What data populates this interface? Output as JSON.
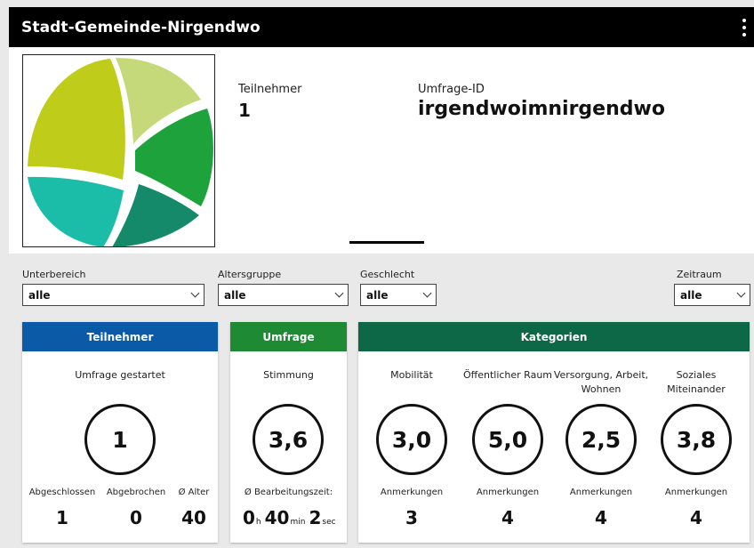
{
  "header": {
    "title": "Stadt-Gemeinde-Nirgendwo"
  },
  "summary": {
    "participants_label": "Teilnehmer",
    "participants_value": "1",
    "survey_id_label": "Umfrage-ID",
    "survey_id_value": "irgendwoimnirgendwo"
  },
  "filters": {
    "subarea": {
      "label": "Unterbereich",
      "value": "alle"
    },
    "age_group": {
      "label": "Altersgruppe",
      "value": "alle"
    },
    "gender": {
      "label": "Geschlecht",
      "value": "alle"
    },
    "period": {
      "label": "Zeitraum",
      "value": "alle"
    }
  },
  "cards": {
    "participants": {
      "title": "Teilnehmer",
      "color": "#0a5aa8",
      "started_label": "Umfrage gestartet",
      "started_value": "1",
      "completed_label": "Abgeschlossen",
      "completed_value": "1",
      "aborted_label": "Abgebrochen",
      "aborted_value": "0",
      "age_label": "Ø Alter",
      "age_value": "40"
    },
    "survey": {
      "title": "Umfrage",
      "color": "#1e8a34",
      "mood_label": "Stimmung",
      "mood_value": "3,6",
      "duration_label": "Ø Bearbeitungszeit:",
      "hours": "0",
      "hours_unit": "h",
      "minutes": "40",
      "minutes_unit": "min",
      "seconds": "2",
      "seconds_unit": "sec"
    },
    "categories": {
      "title": "Kategorien",
      "color": "#0d6848",
      "items": [
        {
          "label": "Mobilität",
          "score": "3,0",
          "notes_label": "Anmerkungen",
          "notes_value": "3"
        },
        {
          "label": "Öffentlicher Raum",
          "score": "5,0",
          "notes_label": "Anmerkungen",
          "notes_value": "4"
        },
        {
          "label": "Versorgung, Arbeit, Wohnen",
          "score": "2,5",
          "notes_label": "Anmerkungen",
          "notes_value": "4"
        },
        {
          "label": "Soziales Miteinander",
          "score": "3,8",
          "notes_label": "Anmerkungen",
          "notes_value": "4"
        }
      ]
    }
  },
  "icons": {
    "menu": "more-vertical-icon",
    "dropdown": "chevron-down-icon",
    "logo": "municipality-logo"
  }
}
